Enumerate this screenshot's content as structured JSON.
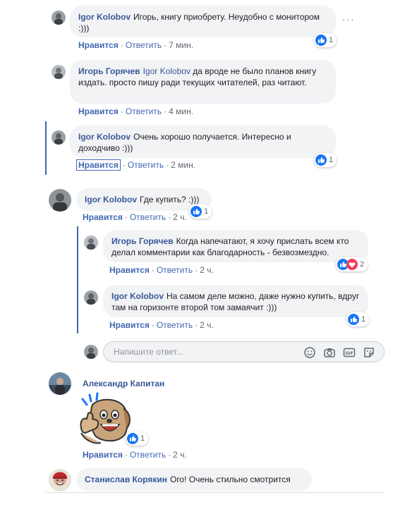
{
  "comments": [
    {
      "author": "Igor Kolobov",
      "text": "Игорь, книгу приобрету. Неудобно с монитором :)))",
      "like_label": "Нравится",
      "reply_label": "Ответить",
      "time": "7 мин.",
      "reactions": "1"
    },
    {
      "author": "Игорь Горячев",
      "mention": "Igor Kolobov",
      "text": "да вроде не было планов книгу издать. просто пишу ради текущих читателей, раз читают.",
      "like_label": "Нравится",
      "reply_label": "Ответить",
      "time": "4 мин."
    },
    {
      "author": "Igor Kolobov",
      "text": "Очень хорошо получается. Интересно и доходчиво :)))",
      "like_label": "Нравится",
      "reply_label": "Ответить",
      "time": "2 мин.",
      "reactions": "1"
    },
    {
      "author": "Igor Kolobov",
      "text": "Где купить? :)))",
      "like_label": "Нравится",
      "reply_label": "Ответить",
      "time": "2 ч.",
      "reactions": "1",
      "replies": [
        {
          "author": "Игорь Горячев",
          "text": "Когда напечатают, я хочу прислать всем кто делал комментарии как благодарность - безвозмездно.",
          "like_label": "Нравится",
          "reply_label": "Ответить",
          "time": "2 ч.",
          "reactions": "2"
        },
        {
          "author": "Igor Kolobov",
          "text": "На самом деле можно, даже нужно купить, вдруг там на горизонте второй том замаячит :)))",
          "like_label": "Нравится",
          "reply_label": "Ответить",
          "time": "2 ч.",
          "reactions": "1"
        }
      ]
    },
    {
      "author": "Александр Капитан",
      "like_label": "Нравится",
      "reply_label": "Ответить",
      "time": "2 ч.",
      "reactions": "1"
    },
    {
      "author": "Станислав Корякин",
      "text": "Ого! Очень стильно смотрится"
    }
  ],
  "reply_box": {
    "placeholder": "Напишите ответ..."
  },
  "colors": {
    "link": "#385898",
    "like": "#4267b2",
    "bubble": "#f2f3f5",
    "love": "#f33e58"
  },
  "icons": [
    "more-options-icon",
    "like-reaction-icon",
    "love-reaction-icon",
    "emoji-icon",
    "camera-icon",
    "gif-icon",
    "sticker-icon"
  ]
}
